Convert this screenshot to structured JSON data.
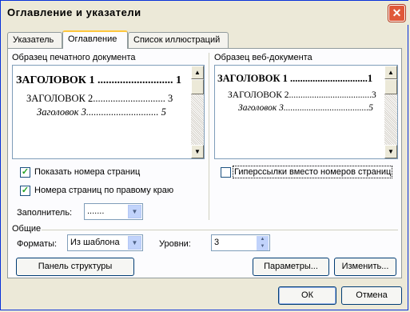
{
  "window": {
    "title": "Оглавление и указатели",
    "close_glyph": "✕"
  },
  "tabs": [
    {
      "label": "Указатель",
      "hotkey_prefix": "",
      "hotkey": "У",
      "rest": "казатель"
    },
    {
      "label": "Оглавление",
      "hotkey": "О",
      "rest": "главление"
    },
    {
      "label": "Список иллюстраций",
      "hotkey": "С",
      "rest": "писок иллюстраций"
    }
  ],
  "print_preview": {
    "label": "Образец печатного документа",
    "lines": [
      {
        "text": "ЗАГОЛОВОК 1 ........................... 1"
      },
      {
        "text": "ЗАГОЛОВОК 2............................. 3"
      },
      {
        "text": "Заголовок 3............................. 5"
      }
    ]
  },
  "web_preview": {
    "label": "Образец веб-документа",
    "lines": [
      {
        "text": "ЗАГОЛОВОК 1 ...............................1"
      },
      {
        "text": "ЗАГОЛОВОК 2....................................3"
      },
      {
        "text": "Заголовок 3.....................................5"
      }
    ]
  },
  "options": {
    "show_page_numbers": {
      "label": "Показать номера страниц",
      "checked": "✓"
    },
    "right_align": {
      "label": "Номера страниц по правому краю",
      "checked": "✓"
    },
    "hyperlinks": {
      "label": "Гиперссылки вместо номеров страниц",
      "checked": ""
    },
    "leader": {
      "label": "Заполнитель:",
      "value": "......."
    }
  },
  "general": {
    "label": "Общие",
    "formats": {
      "label": "Форматы:",
      "value": "Из шаблона"
    },
    "levels": {
      "label": "Уровни:",
      "value": "3"
    }
  },
  "buttons": {
    "outline_panel": "Панель структуры",
    "parameters": "Параметры...",
    "modify": "Изменить...",
    "ok": "ОК",
    "cancel": "Отмена"
  },
  "icons": {
    "scroll_up": "▲",
    "scroll_down": "▼",
    "combo_arrow": "▼",
    "spin_up": "▲",
    "spin_down": "▼"
  }
}
